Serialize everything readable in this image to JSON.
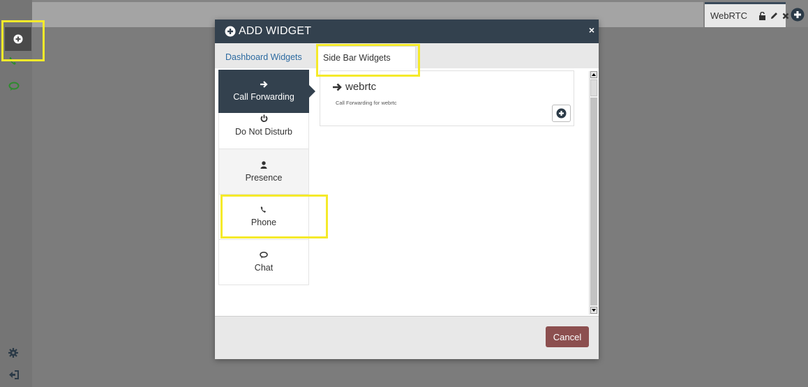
{
  "header_tab": {
    "label": "WebRTC"
  },
  "modal": {
    "title": "ADD WIDGET",
    "close": "×",
    "tabs": [
      {
        "label": "Dashboard Widgets"
      },
      {
        "label": "Side Bar Widgets"
      }
    ],
    "widgets": [
      {
        "label": "Call Forwarding",
        "icon": "arrow-right-icon"
      },
      {
        "label": "Do Not Disturb",
        "icon": "power-icon"
      },
      {
        "label": "Presence",
        "icon": "user-icon"
      },
      {
        "label": "Phone",
        "icon": "phone-icon"
      },
      {
        "label": "Chat",
        "icon": "chat-icon"
      }
    ],
    "card": {
      "title": "webrtc",
      "description": "Call Forwarding for webrtc"
    },
    "cancel_label": "Cancel"
  },
  "colors": {
    "header": "#33414e",
    "accent_link": "#2c6aa0",
    "cancel": "#8c4f4f",
    "highlight": "#f5ea2a",
    "sidebar_green": "#2e8b2e"
  }
}
